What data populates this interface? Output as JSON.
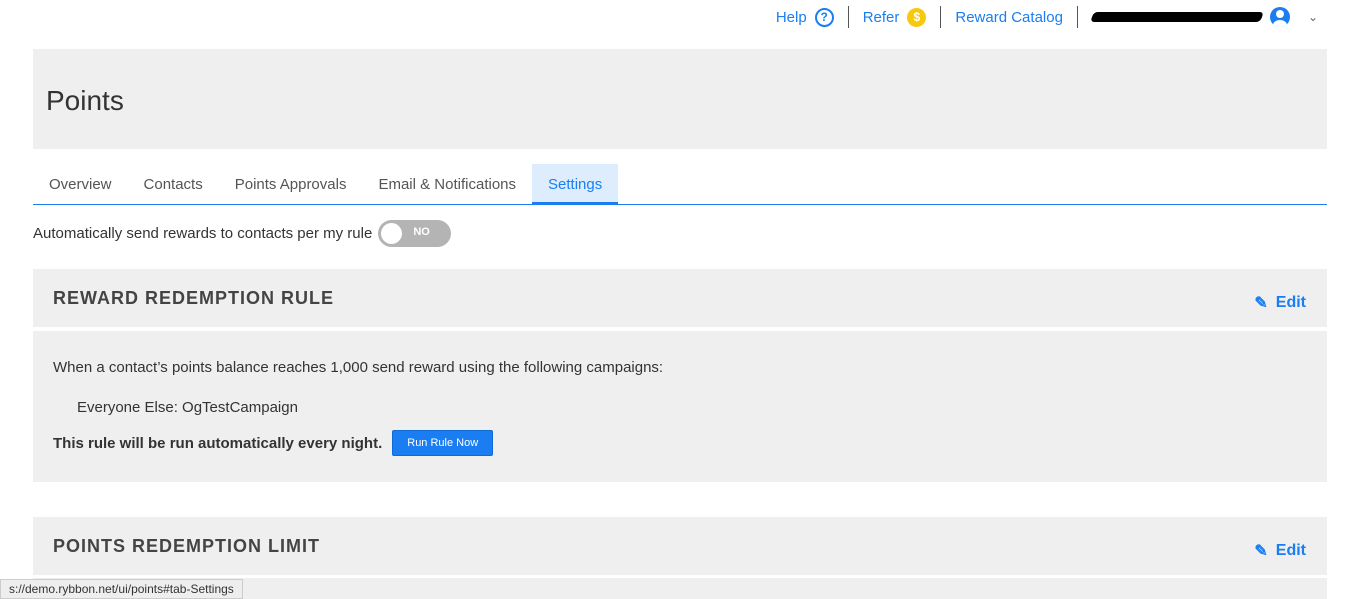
{
  "topnav": {
    "help": "Help",
    "refer": "Refer",
    "reward_catalog": "Reward Catalog",
    "coin_symbol": "$",
    "help_symbol": "?"
  },
  "header": {
    "title": "Points"
  },
  "tabs": [
    {
      "label": "Overview"
    },
    {
      "label": "Contacts"
    },
    {
      "label": "Points Approvals"
    },
    {
      "label": "Email & Notifications"
    },
    {
      "label": "Settings"
    }
  ],
  "auto_send": {
    "label": "Automatically send rewards to contacts per my rule",
    "toggle": "NO"
  },
  "redemption_rule": {
    "title": "REWARD REDEMPTION RULE",
    "edit": "Edit",
    "description": "When a contact’s points balance reaches 1,000 send reward using the following campaigns:",
    "campaign": "Everyone Else: OgTestCampaign",
    "note": "This rule will be run automatically every night.",
    "run_button": "Run Rule Now"
  },
  "redemption_limit": {
    "title": "POINTS REDEMPTION LIMIT",
    "edit": "Edit"
  },
  "status_bar": "s://demo.rybbon.net/ui/points#tab-Settings",
  "colors": {
    "accent": "#1a7ef2",
    "panel": "#efefef"
  }
}
